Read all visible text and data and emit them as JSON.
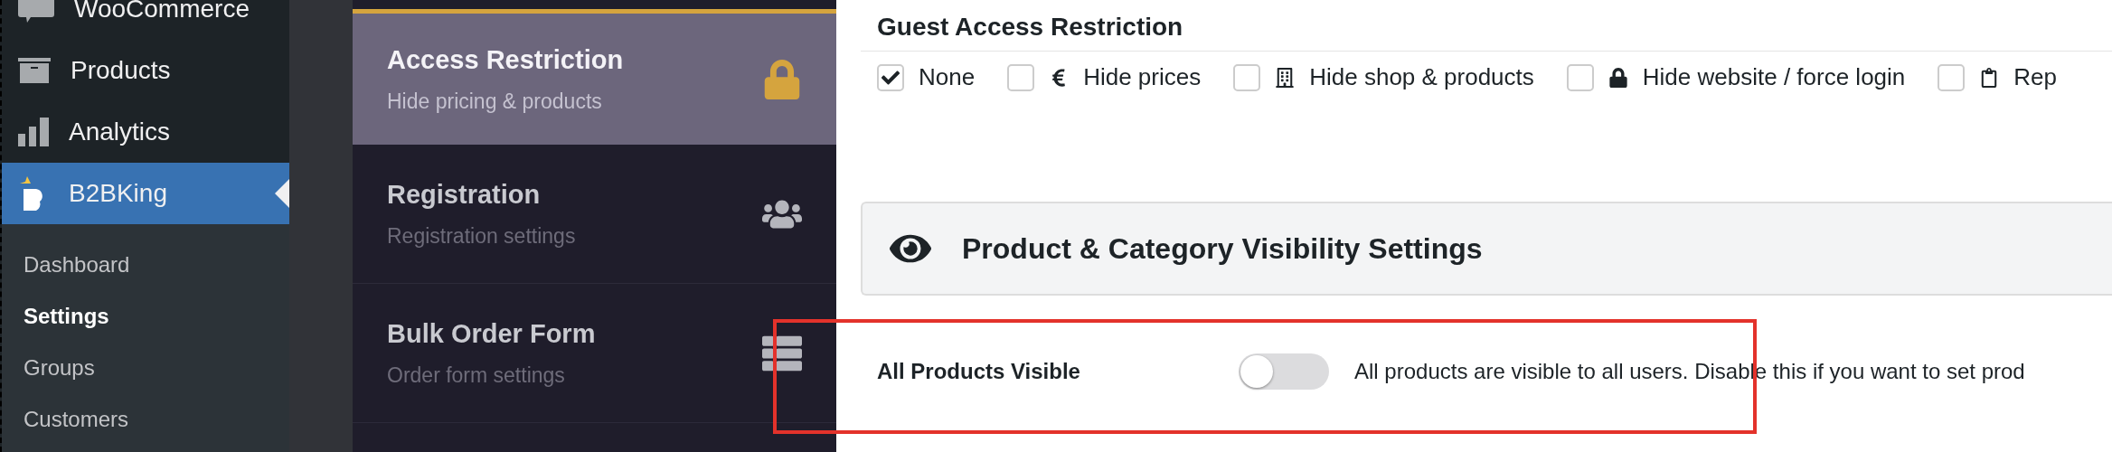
{
  "admin_menu": {
    "items": [
      {
        "label": "WooCommerce",
        "selected": false
      },
      {
        "label": "Products",
        "selected": false
      },
      {
        "label": "Analytics",
        "selected": false
      },
      {
        "label": "B2BKing",
        "selected": true
      }
    ],
    "submenu": [
      {
        "label": "Dashboard",
        "selected": false
      },
      {
        "label": "Settings",
        "selected": true
      },
      {
        "label": "Groups",
        "selected": false
      },
      {
        "label": "Customers",
        "selected": false
      }
    ]
  },
  "settings_menu": [
    {
      "title": "Access Restriction",
      "subtitle": "Hide pricing & products",
      "selected": true
    },
    {
      "title": "Registration",
      "subtitle": "Registration settings",
      "selected": false
    },
    {
      "title": "Bulk Order Form",
      "subtitle": "Order form settings",
      "selected": false
    }
  ],
  "guest_access": {
    "title": "Guest Access Restriction",
    "options": [
      {
        "label": "None",
        "checked": true
      },
      {
        "label": "Hide prices",
        "checked": false
      },
      {
        "label": "Hide shop & products",
        "checked": false
      },
      {
        "label": "Hide website / force login",
        "checked": false
      },
      {
        "label": "Rep",
        "checked": false
      }
    ]
  },
  "visibility_section": {
    "title": "Product & Category Visibility Settings"
  },
  "all_products_visible": {
    "label": "All Products Visible",
    "on": false,
    "description": "All products are visible to all users. Disable this if you want to set prod"
  }
}
